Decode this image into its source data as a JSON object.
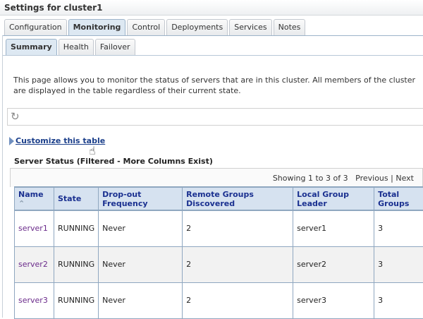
{
  "title": "Settings for cluster1",
  "tabs": [
    "Configuration",
    "Monitoring",
    "Control",
    "Deployments",
    "Services",
    "Notes"
  ],
  "active_tab": "Monitoring",
  "subtabs": [
    "Summary",
    "Health",
    "Failover"
  ],
  "active_subtab": "Summary",
  "description": "This page allows you to monitor the status of servers that are in this cluster. All members of the cluster are displayed in the table regardless of their current state.",
  "customize_link": "Customize this table",
  "table_title": "Server Status (Filtered - More Columns Exist)",
  "pager": {
    "showing": "Showing 1 to 3 of 3",
    "previous": "Previous",
    "separator": "|",
    "next": "Next"
  },
  "columns": [
    "Name",
    "State",
    "Drop-out Frequency",
    "Remote Groups Discovered",
    "Local Group Leader",
    "Total Groups"
  ],
  "rows": [
    [
      "server1",
      "RUNNING",
      "Never",
      "2",
      "server1",
      "3"
    ],
    [
      "server2",
      "RUNNING",
      "Never",
      "2",
      "server2",
      "3"
    ],
    [
      "server3",
      "RUNNING",
      "Never",
      "2",
      "server3",
      "3"
    ]
  ]
}
